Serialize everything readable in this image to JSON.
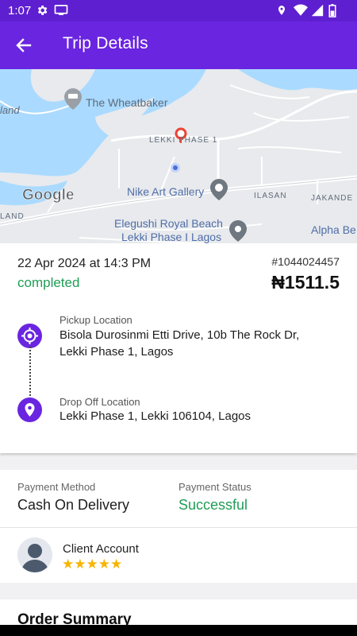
{
  "status_bar": {
    "time": "1:07"
  },
  "app_bar": {
    "title": "Trip Details"
  },
  "map": {
    "labels": {
      "wheatbaker": "The Wheatbaker",
      "lekki_phase1": "LEKKI PHASE 1",
      "nike": "Nike Art Gallery",
      "ilasan": "ILASAN",
      "jakande": "JAKANDE",
      "elegushi_1": "Elegushi Royal Beach",
      "elegushi_2": "Lekki Phase I Lagos",
      "alpha": "Alpha Be",
      "island": "land",
      "land": "LAND",
      "google": "Google"
    }
  },
  "trip": {
    "date": "22 Apr 2024 at 14:3 PM",
    "status": "completed",
    "order_id": "#1044024457",
    "price": "₦1511.5",
    "pickup_label": "Pickup Location",
    "pickup_value": "Bisola Durosinmi Etti Drive, 10b The Rock Dr, Lekki Phase 1, Lagos",
    "dropoff_label": "Drop Off Location",
    "dropoff_value": "Lekki Phase 1, Lekki 106104, Lagos"
  },
  "payment": {
    "method_label": "Payment Method",
    "method_value": "Cash On Delivery",
    "status_label": "Payment Status",
    "status_value": "Successful"
  },
  "client": {
    "label": "Client Account",
    "stars": "★★★★★",
    "rating": 5
  },
  "order_summary": {
    "title": "Order Summary"
  },
  "colors": {
    "primary": "#6a25e0",
    "success": "#1f9d55",
    "star": "#f7b500"
  }
}
